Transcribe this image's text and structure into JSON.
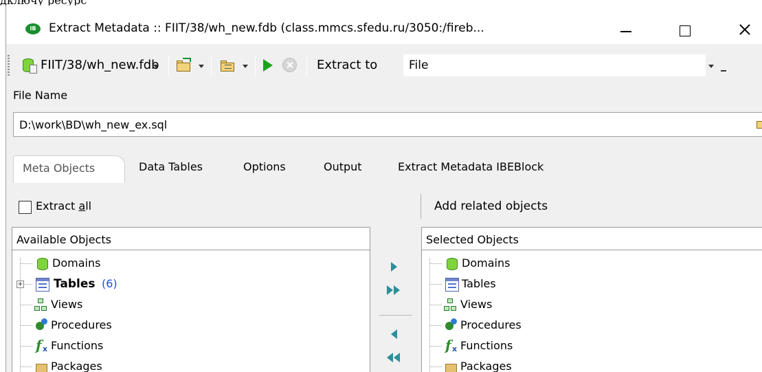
{
  "window": {
    "title": "Extract Metadata :: FIIT/38/wh_new.fdb (class.mmcs.sfedu.ru/3050:/fireb...",
    "logo_text": "IB"
  },
  "toolbar": {
    "database_label": "FIIT/38/wh_new.fdb",
    "extract_to_label": "Extract to",
    "extract_to_value": "File"
  },
  "file": {
    "label": "File Name",
    "value": "D:\\work\\BD\\wh_new_ex.sql"
  },
  "tabs": [
    {
      "label": "Meta Objects",
      "active": true
    },
    {
      "label": "Data Tables",
      "active": false
    },
    {
      "label": "Options",
      "active": false
    },
    {
      "label": "Output",
      "active": false
    },
    {
      "label": "Extract Metadata IBEBlock",
      "active": false
    }
  ],
  "options": {
    "extract_all_prefix": "Extract ",
    "extract_all_underlined": "a",
    "extract_all_suffix": "ll",
    "extract_all_checked": false,
    "add_related_label": "Add related objects"
  },
  "available": {
    "header": "Available Objects",
    "items": [
      {
        "label": "Domains",
        "icon": "domain-icon"
      },
      {
        "label": "Tables",
        "count": "(6)",
        "icon": "table-icon",
        "bold": true,
        "expandable": true
      },
      {
        "label": "Views",
        "icon": "views-icon"
      },
      {
        "label": "Procedures",
        "icon": "procedures-icon"
      },
      {
        "label": "Functions",
        "icon": "functions-icon"
      },
      {
        "label": "Packages",
        "icon": "package-icon"
      }
    ]
  },
  "selected": {
    "header": "Selected Objects",
    "items": [
      {
        "label": "Domains",
        "icon": "domain-icon"
      },
      {
        "label": "Tables",
        "icon": "table-icon"
      },
      {
        "label": "Views",
        "icon": "views-icon"
      },
      {
        "label": "Procedures",
        "icon": "procedures-icon"
      },
      {
        "label": "Functions",
        "icon": "functions-icon"
      },
      {
        "label": "Packages",
        "icon": "package-icon"
      }
    ]
  },
  "background_text": "дключу ресурс"
}
